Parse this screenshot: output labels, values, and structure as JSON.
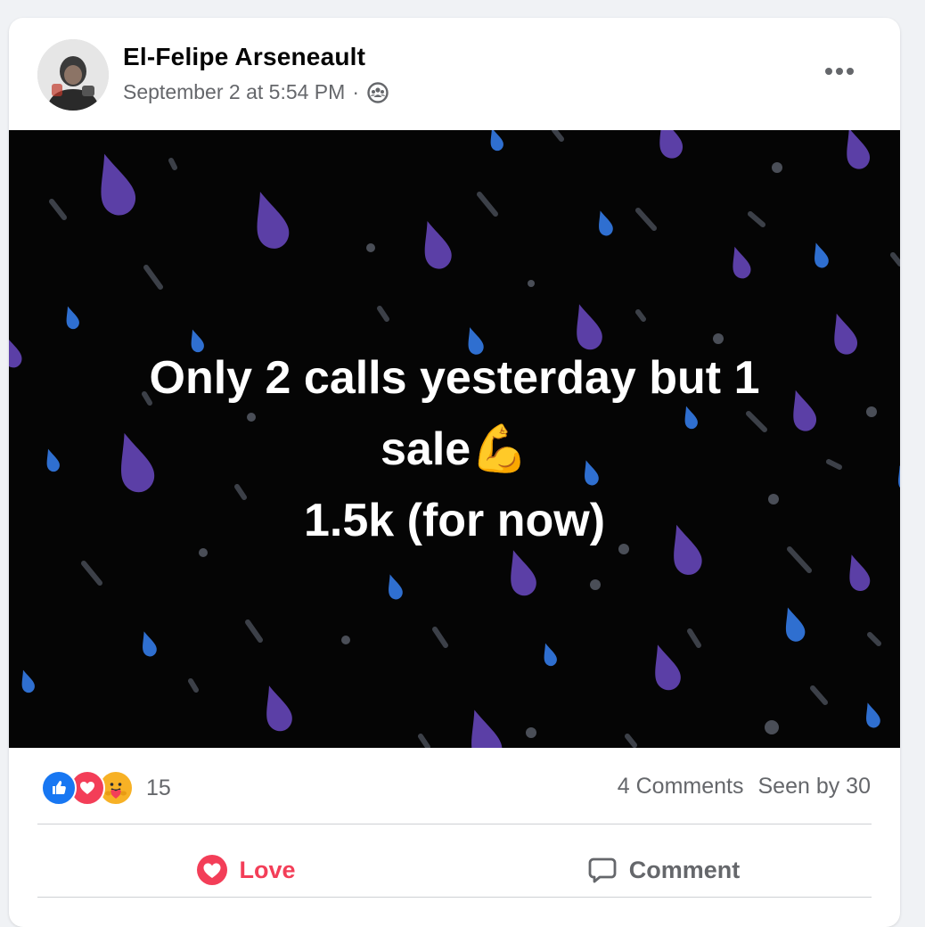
{
  "post": {
    "author": "El-Felipe Arseneault",
    "timestamp": "September 2 at 5:54 PM",
    "separator": "·",
    "audience_icon": "group-audience-icon",
    "more_icon": "more-options-icon",
    "text_lines": [
      "Only 2 calls yesterday but 1",
      "sale💪",
      "1.5k (for now)"
    ],
    "background": "raindrop-pattern",
    "colors": {
      "background": "#050505",
      "drop_purple": "#5b3fa6",
      "drop_blue": "#2f6fd0",
      "love": "#f33e58",
      "like": "#1877f2",
      "muted_text": "#65676b"
    }
  },
  "reactions": {
    "icons": [
      "like-reaction-icon",
      "love-reaction-icon",
      "care-reaction-icon"
    ],
    "count": "15"
  },
  "stats": {
    "comments": "4 Comments",
    "seen": "Seen by 30"
  },
  "actions": {
    "love_label": "Love",
    "comment_label": "Comment"
  }
}
